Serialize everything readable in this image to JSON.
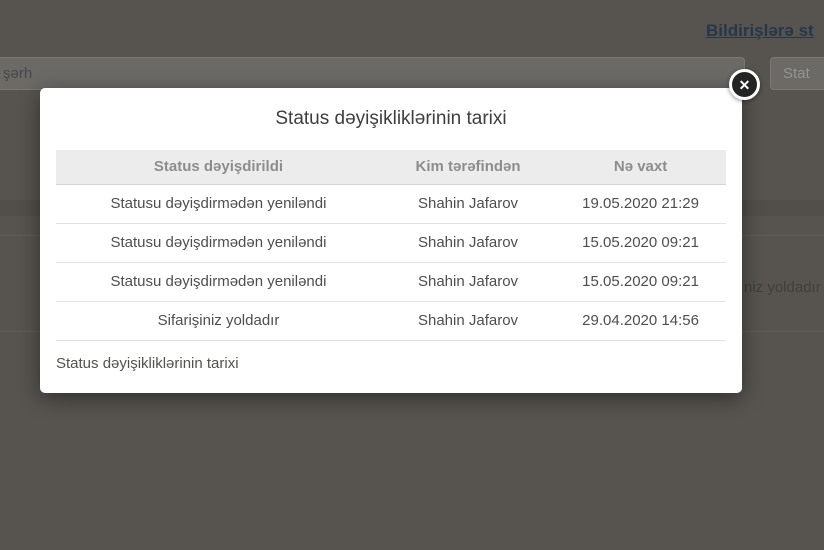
{
  "background": {
    "notifications_link": "Bildirişlərə st",
    "comment_input_placeholder": "şərh",
    "status_button_label": "Stat",
    "status_text_fragment": "niz yoldadır"
  },
  "modal": {
    "title": "Status dəyişikliklərinin tarixi",
    "close_icon": "✕",
    "footer_text": "Status dəyişikliklərinin tarixi",
    "table": {
      "headers": [
        "Status dəyişdirildi",
        "Kim tərəfindən",
        "Nə vaxt"
      ],
      "rows": [
        {
          "status": "Statusu dəyişdirmədən yeniləndi",
          "by": "Shahin Jafarov",
          "when": "19.05.2020 21:29"
        },
        {
          "status": "Statusu dəyişdirmədən yeniləndi",
          "by": "Shahin Jafarov",
          "when": "15.05.2020 09:21"
        },
        {
          "status": "Statusu dəyişdirmədən yeniləndi",
          "by": "Shahin Jafarov",
          "when": "15.05.2020 09:21"
        },
        {
          "status": "Sifarişiniz yoldadır",
          "by": "Shahin Jafarov",
          "when": "29.04.2020 14:56"
        }
      ]
    }
  },
  "colors": {
    "backdrop": "#575450",
    "modal_bg": "#ffffff",
    "table_header_bg": "#ececec",
    "link": "#26374a",
    "close_button_bg": "#242424"
  }
}
